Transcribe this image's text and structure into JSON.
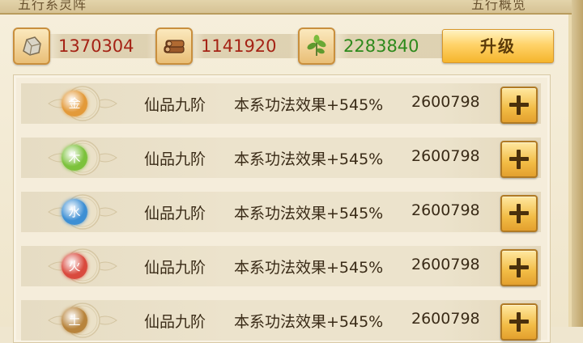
{
  "header": {
    "title_left": "五行系灵阵",
    "title_right": "五行概览"
  },
  "resources": [
    {
      "icon": "ore-stone-icon",
      "value": "1370304",
      "color": "#a52315"
    },
    {
      "icon": "wood-logs-icon",
      "value": "1141920",
      "color": "#a52315"
    },
    {
      "icon": "herb-leaf-icon",
      "value": "2283840",
      "color": "#2d8a1c"
    }
  ],
  "upgrade_label": "升级",
  "elements": [
    {
      "char": "金",
      "color": "#e39a3a",
      "rank": "仙品九阶",
      "effect": "本系功法效果+545%",
      "cost": "2600798"
    },
    {
      "char": "木",
      "color": "#7cc23c",
      "rank": "仙品九阶",
      "effect": "本系功法效果+545%",
      "cost": "2600798"
    },
    {
      "char": "水",
      "color": "#3d8fd4",
      "rank": "仙品九阶",
      "effect": "本系功法效果+545%",
      "cost": "2600798"
    },
    {
      "char": "火",
      "color": "#d94a3e",
      "rank": "仙品九阶",
      "effect": "本系功法效果+545%",
      "cost": "2600798"
    },
    {
      "char": "土",
      "color": "#b8843c",
      "rank": "仙品九阶",
      "effect": "本系功法效果+545%",
      "cost": "2600798"
    }
  ]
}
